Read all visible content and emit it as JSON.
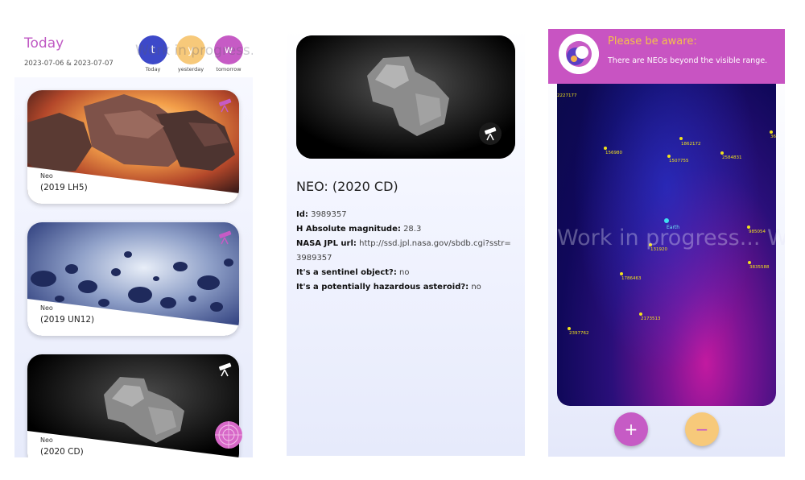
{
  "list_screen": {
    "title": "Today",
    "date_range": "2023-07-06 & 2023-07-07",
    "watermark": "Work in progress...",
    "day_buttons": [
      {
        "letter": "t",
        "label": "Today",
        "color": "#3d49c9"
      },
      {
        "letter": "y",
        "label": "yesterday",
        "color": "#f7c97a"
      },
      {
        "letter": "w",
        "label": "tomorrow",
        "color": "#c65bc5"
      }
    ],
    "cards": [
      {
        "kind": "Neo",
        "name": "(2019 LH5)",
        "image": "asteroid-fire-image",
        "icon": "telescope-icon"
      },
      {
        "kind": "Neo",
        "name": "(2019 UN12)",
        "image": "asteroid-field-image",
        "icon": "telescope-icon"
      },
      {
        "kind": "Neo",
        "name": "(2020 CD)",
        "image": "comet-image",
        "icon": "telescope-icon"
      }
    ],
    "radar_icon": "radar-icon"
  },
  "detail_screen": {
    "image": "comet-image",
    "icon": "telescope-icon",
    "title": "NEO: (2020 CD)",
    "fields": [
      {
        "label": "Id:",
        "value": "3989357"
      },
      {
        "label": "H Absolute magnitude:",
        "value": "28.3"
      },
      {
        "label": "NASA JPL url:",
        "value": "http://ssd.jpl.nasa.gov/sbdb.cgi?sstr=3989357"
      },
      {
        "label": "It's a sentinel object?:",
        "value": "no"
      },
      {
        "label": "It's a potentially hazardous asteroid?:",
        "value": "no"
      }
    ]
  },
  "map_screen": {
    "alert_title": "Please be aware:",
    "alert_text": "There are NEOs beyond the visible range.",
    "watermark": "Work in progress... Wo",
    "earth_label": "Earth",
    "neos": [
      "2227177",
      "1862172",
      "156980",
      "1507755",
      "2584831",
      "36",
      "985054",
      "131920",
      "3835588",
      "1786463",
      "2173513",
      "2397762"
    ],
    "zoom_in_label": "+",
    "zoom_out_label": "−",
    "colors": {
      "zoom_in": "#c65bc5",
      "zoom_out": "#f7c97a",
      "alert_bg": "#c854c2",
      "alert_title": "#f5c04a"
    }
  }
}
